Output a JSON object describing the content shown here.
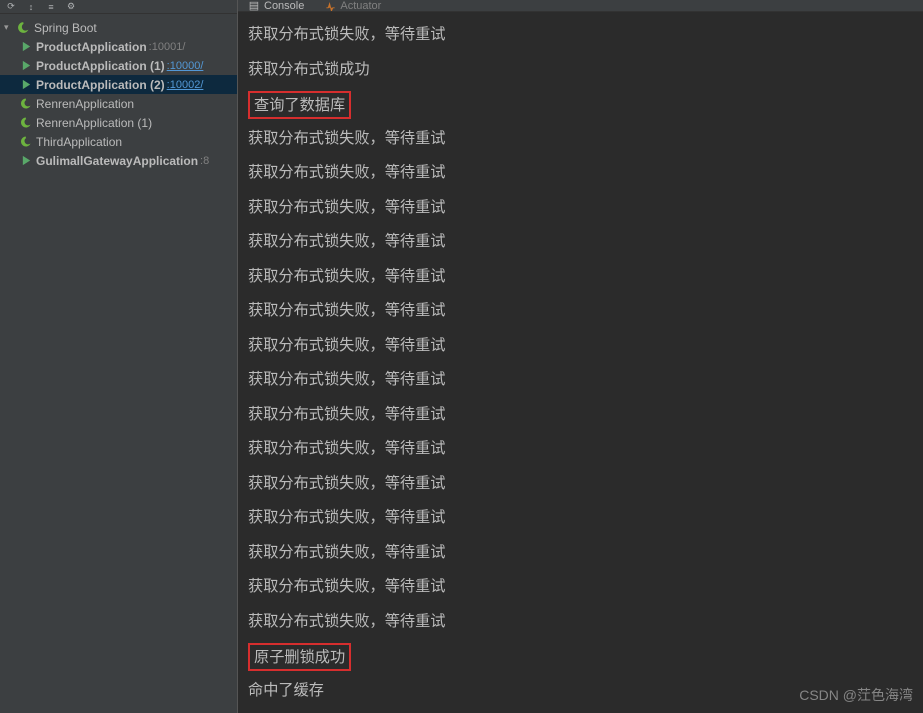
{
  "sidebar": {
    "root_label": "Spring Boot",
    "items": [
      {
        "label": "ProductApplication",
        "port": ":10001/",
        "bold": true,
        "running": true,
        "link": false
      },
      {
        "label": "ProductApplication (1)",
        "port": ":10000/",
        "bold": true,
        "running": true,
        "link": true
      },
      {
        "label": "ProductApplication (2)",
        "port": ":10002/",
        "bold": true,
        "running": true,
        "link": true,
        "selected": true
      },
      {
        "label": "RenrenApplication",
        "port": "",
        "bold": false,
        "running": false
      },
      {
        "label": "RenrenApplication (1)",
        "port": "",
        "bold": false,
        "running": false
      },
      {
        "label": "ThirdApplication",
        "port": "",
        "bold": false,
        "running": false
      },
      {
        "label": "GulimallGatewayApplication",
        "port": ":8",
        "bold": true,
        "running": true,
        "link": false
      }
    ]
  },
  "tabs": {
    "console": "Console",
    "actuator": "Actuator"
  },
  "console": {
    "lines": [
      {
        "text": "获取分布式锁失败，等待重试",
        "highlight": false
      },
      {
        "text": "获取分布式锁成功",
        "highlight": false
      },
      {
        "text": "查询了数据库",
        "highlight": true
      },
      {
        "text": "获取分布式锁失败，等待重试",
        "highlight": false
      },
      {
        "text": "获取分布式锁失败，等待重试",
        "highlight": false
      },
      {
        "text": "获取分布式锁失败，等待重试",
        "highlight": false
      },
      {
        "text": "获取分布式锁失败，等待重试",
        "highlight": false
      },
      {
        "text": "获取分布式锁失败，等待重试",
        "highlight": false
      },
      {
        "text": "获取分布式锁失败，等待重试",
        "highlight": false
      },
      {
        "text": "获取分布式锁失败，等待重试",
        "highlight": false
      },
      {
        "text": "获取分布式锁失败，等待重试",
        "highlight": false
      },
      {
        "text": "获取分布式锁失败，等待重试",
        "highlight": false
      },
      {
        "text": "获取分布式锁失败，等待重试",
        "highlight": false
      },
      {
        "text": "获取分布式锁失败，等待重试",
        "highlight": false
      },
      {
        "text": "获取分布式锁失败，等待重试",
        "highlight": false
      },
      {
        "text": "获取分布式锁失败，等待重试",
        "highlight": false
      },
      {
        "text": "获取分布式锁失败，等待重试",
        "highlight": false
      },
      {
        "text": "获取分布式锁失败，等待重试",
        "highlight": false
      },
      {
        "text": "原子删锁成功",
        "highlight": true
      },
      {
        "text": "命中了缓存",
        "highlight": false
      }
    ]
  },
  "watermark": "CSDN @茳色海湾"
}
